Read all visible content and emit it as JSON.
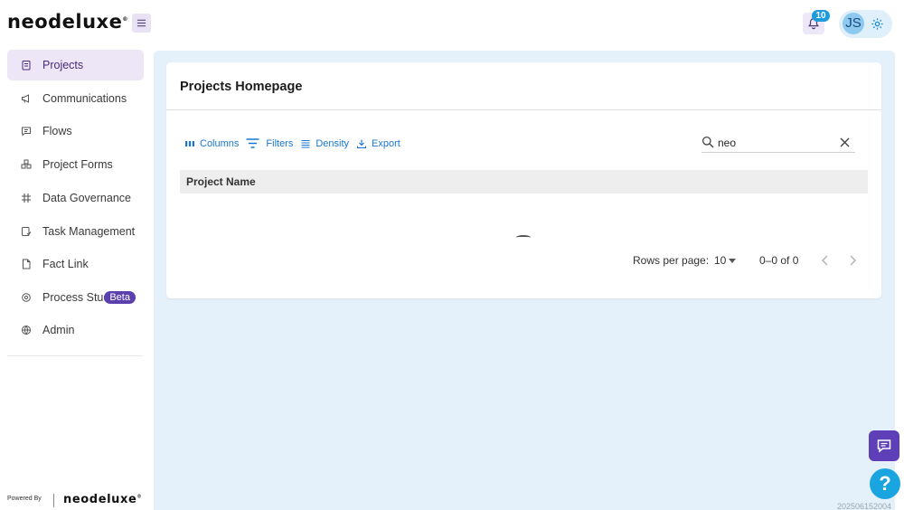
{
  "brand": {
    "logo_text": "neodeluxe",
    "logo_mark": "®"
  },
  "header": {
    "menu_icon": "hamburger-icon",
    "notifications": {
      "icon": "bell-icon",
      "count": "10"
    },
    "user": {
      "initials": "JS",
      "settings_icon": "gear-icon"
    }
  },
  "sidebar": {
    "items": [
      {
        "label": "Projects",
        "icon": "clipboard-icon",
        "active": true
      },
      {
        "label": "Communications",
        "icon": "megaphone-icon"
      },
      {
        "label": "Flows",
        "icon": "chat-icon"
      },
      {
        "label": "Project Forms",
        "icon": "forms-icon"
      },
      {
        "label": "Data Governance",
        "icon": "grid-icon"
      },
      {
        "label": "Task Management",
        "icon": "task-icon"
      },
      {
        "label": "Fact Link",
        "icon": "file-icon"
      },
      {
        "label": "Process Stud",
        "icon": "process-icon",
        "badge": "Beta"
      },
      {
        "label": "Admin",
        "icon": "globe-icon"
      }
    ],
    "footer": {
      "powered_by": "Powered By",
      "logo_text": "neodeluxe",
      "logo_mark": "®"
    }
  },
  "main": {
    "title": "Projects Homepage",
    "toolbar": {
      "columns": "Columns",
      "filters": "Filters",
      "density": "Density",
      "export": "Export"
    },
    "search": {
      "value": "neo"
    },
    "table": {
      "columns": [
        "Project Name"
      ],
      "rows": []
    },
    "pagination": {
      "rows_per_page_label": "Rows per page:",
      "rows_per_page_value": "10",
      "range": "0–0 of 0"
    }
  },
  "build_number": "202506152004",
  "colors": {
    "accent": "#5e3fb8",
    "link": "#1976d2",
    "main_bg": "#e4f0fa",
    "help": "#1ba5e0"
  }
}
